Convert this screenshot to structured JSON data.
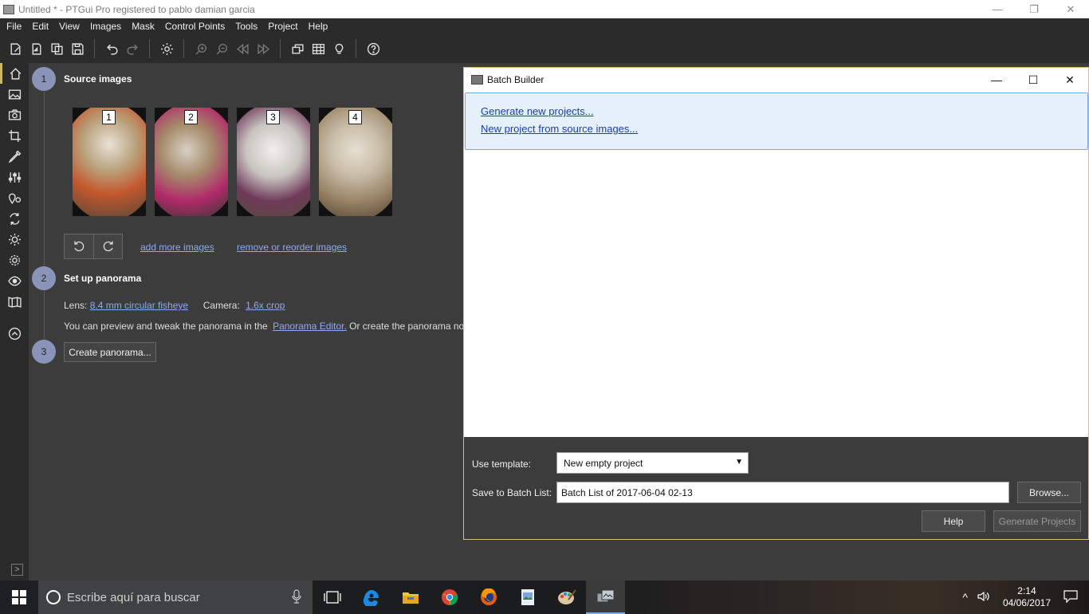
{
  "window": {
    "title": "Untitled * - PTGui Pro registered to pablo damian garcia",
    "minimize_glyph": "—",
    "restore_glyph": "❐",
    "close_glyph": "✕"
  },
  "menu": [
    "File",
    "Edit",
    "View",
    "Images",
    "Mask",
    "Control Points",
    "Tools",
    "Project",
    "Help"
  ],
  "toolbar": {
    "icons": [
      "new-project-icon",
      "open-icon",
      "save-as-icon",
      "save-icon",
      "undo-icon",
      "redo-icon",
      "settings-icon",
      "zoom-in-icon",
      "zoom-out-icon",
      "previous-icon",
      "next-icon",
      "panorama-editor-icon",
      "control-point-table-icon",
      "lightbulb-icon",
      "help-icon"
    ]
  },
  "sidebar": {
    "icons": [
      "home-icon",
      "image-icon",
      "camera-icon",
      "crop-icon",
      "mask-icon",
      "sliders-icon",
      "control-points-icon",
      "optimizer-icon",
      "exposure-icon",
      "settings-icon",
      "preview-icon",
      "create-panorama-icon",
      "collapse-icon"
    ],
    "expand_glyph": ">"
  },
  "project": {
    "step1": {
      "number": "1",
      "title": "Source images"
    },
    "images": [
      {
        "label": "1",
        "colors": [
          "#b9a07a",
          "#c4582e",
          "#6b4a36"
        ]
      },
      {
        "label": "2",
        "colors": [
          "#a58a6a",
          "#b02a6a",
          "#3d3630"
        ]
      },
      {
        "label": "3",
        "colors": [
          "#c8c4c0",
          "#6f3a5a",
          "#5a4a40"
        ]
      },
      {
        "label": "4",
        "colors": [
          "#9a8466",
          "#c8bda8",
          "#5a4a38"
        ]
      }
    ],
    "add_more": "add more images",
    "remove_reorder": "remove or reorder images",
    "step2": {
      "number": "2",
      "title": "Set up panorama"
    },
    "lens_label": "Lens:",
    "lens_value": "8.4 mm circular fisheye",
    "camera_label": "Camera:",
    "camera_value": "1.6x crop",
    "preview_text": "You can preview and tweak the panorama in the",
    "panorama_editor_link": "Panorama Editor.",
    "preview_text_tail": "Or create the panorama now",
    "step3": {
      "number": "3"
    },
    "create_button": "Create panorama..."
  },
  "batch_builder": {
    "title": "Batch Builder",
    "link_generate": "Generate new projects...",
    "link_new_from_source": "New project from source images...",
    "template_label": "Use template:",
    "template_value": "New empty project",
    "save_label": "Save to Batch List:",
    "save_value": "Batch List of 2017-06-04 02-13",
    "browse": "Browse...",
    "help": "Help",
    "generate": "Generate Projects"
  },
  "taskbar": {
    "search_placeholder": "Escribe aquí para buscar",
    "time": "2:14",
    "date": "04/06/2017",
    "apps": [
      "task-view-icon",
      "edge-icon",
      "file-explorer-icon",
      "chrome-icon",
      "firefox-icon",
      "image-viewer-icon",
      "paint-icon",
      "ptgui-icon"
    ]
  }
}
